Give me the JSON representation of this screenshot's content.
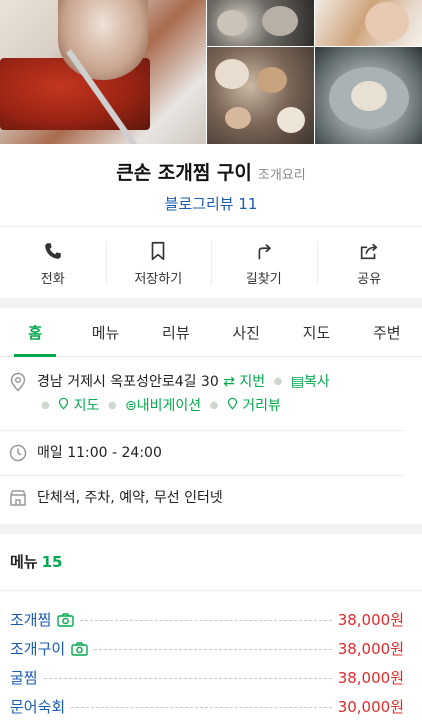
{
  "place": {
    "name": "큰손 조개찜 구이",
    "category": "조개요리",
    "blog_review": "블로그리뷰 11"
  },
  "actions": [
    {
      "label": "전화",
      "icon": "phone-icon"
    },
    {
      "label": "저장하기",
      "icon": "bookmark-icon"
    },
    {
      "label": "길찾기",
      "icon": "directions-icon"
    },
    {
      "label": "공유",
      "icon": "share-icon"
    }
  ],
  "tabs": [
    {
      "label": "홈",
      "active": true
    },
    {
      "label": "메뉴"
    },
    {
      "label": "리뷰"
    },
    {
      "label": "사진"
    },
    {
      "label": "지도"
    },
    {
      "label": "주변"
    }
  ],
  "info": {
    "address": "경남 거제시 옥포성안로4길 30",
    "jibun": "지번",
    "copy": "복사",
    "map": "지도",
    "navigation": "내비게이션",
    "street_view": "거리뷰",
    "hours": "매일 11:00 - 24:00",
    "facilities": "단체석, 주차, 예약, 무선 인터넷"
  },
  "menu": {
    "title": "메뉴",
    "count": "15",
    "items": [
      {
        "name": "조개찜",
        "price": "38,000원",
        "has_photo": true
      },
      {
        "name": "조개구이",
        "price": "38,000원",
        "has_photo": true
      },
      {
        "name": "굴찜",
        "price": "38,000원",
        "has_photo": false
      },
      {
        "name": "문어숙회",
        "price": "30,000원",
        "has_photo": false
      }
    ]
  },
  "colors": {
    "accent_green": "#03a94d",
    "link_blue": "#1b5bb3",
    "price_red": "#e02a2a"
  }
}
